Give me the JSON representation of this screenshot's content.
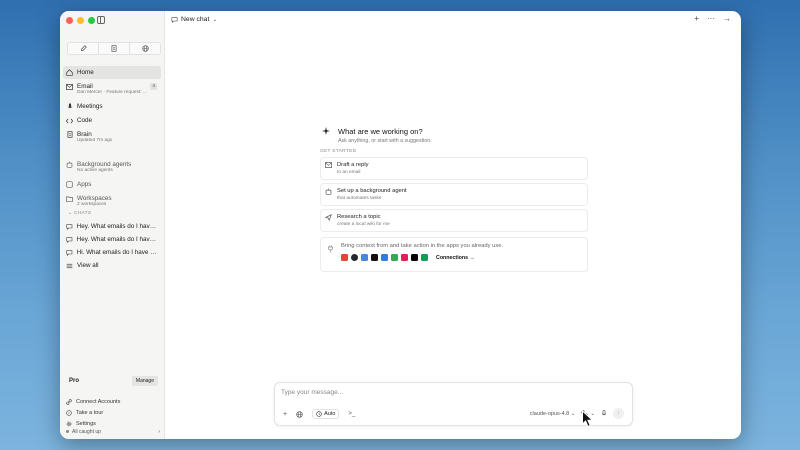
{
  "window": {
    "title": "New chat"
  },
  "sidebar": {
    "nav": [
      {
        "label": "Home",
        "sub": "",
        "icon": "home-icon"
      },
      {
        "label": "Email",
        "sub": "Dan Mercer · Feature request: ...",
        "icon": "mail-icon",
        "badge": "4"
      },
      {
        "label": "Meetings",
        "sub": "",
        "icon": "microphone-icon"
      },
      {
        "label": "Code",
        "sub": "",
        "icon": "code-icon"
      },
      {
        "label": "Brain",
        "sub": "Updated 7m ago",
        "icon": "document-icon"
      },
      {
        "label": "Background agents",
        "sub": "No active agents",
        "icon": "agents-icon"
      },
      {
        "label": "Apps",
        "sub": "",
        "icon": "apps-icon"
      },
      {
        "label": "Workspaces",
        "sub": "2 workspaces",
        "icon": "folder-icon"
      }
    ],
    "chats_header": "CHATS",
    "chats": [
      "Hey. What emails do I have f...",
      "Hey. What emails do I have f...",
      "Hi. What emails do I have for...",
      "View all"
    ],
    "plan": {
      "label": "Pro",
      "manage": "Manage"
    },
    "footer": [
      {
        "label": "Connect Accounts",
        "icon": "link-icon"
      },
      {
        "label": "Take a tour",
        "icon": "compass-icon"
      },
      {
        "label": "Settings",
        "icon": "gear-icon"
      }
    ],
    "status": "All caught up"
  },
  "main": {
    "welcome_title": "What are we working on?",
    "welcome_sub": "Ask anything, or start with a suggestion.",
    "get_started": "GET STARTED",
    "cards": [
      {
        "title": "Draft a reply",
        "sub": "to an email",
        "icon": "mail-icon"
      },
      {
        "title": "Set up a background agent",
        "sub": "that automates tasks",
        "icon": "agents-icon"
      },
      {
        "title": "Research a topic",
        "sub": "create a local wiki for me",
        "icon": "send-icon"
      }
    ],
    "connections": {
      "text": "Bring context from and take action in the apps you already use.",
      "link": "Connections →",
      "apps": [
        {
          "name": "gmail-icon",
          "color": "#ea4335"
        },
        {
          "name": "github-icon",
          "color": "#24292e"
        },
        {
          "name": "calendar-icon",
          "color": "#4a86d8"
        },
        {
          "name": "notion-icon",
          "color": "#111111"
        },
        {
          "name": "sheets-icon",
          "color": "#2b7fd6"
        },
        {
          "name": "meet-icon",
          "color": "#34a853"
        },
        {
          "name": "slack-icon",
          "color": "#e01e5a"
        },
        {
          "name": "x-icon",
          "color": "#000000"
        },
        {
          "name": "drive-icon",
          "color": "#0f9d58"
        }
      ]
    }
  },
  "composer": {
    "placeholder": "Type your message...",
    "mode": "Auto",
    "model": "claude-opus-4.8"
  }
}
